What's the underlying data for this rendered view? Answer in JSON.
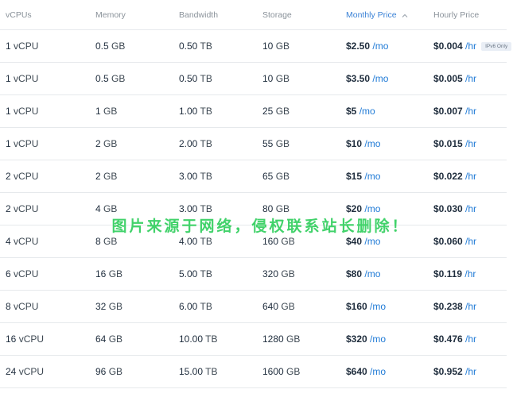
{
  "columns": {
    "vcpus": "vCPUs",
    "memory": "Memory",
    "bandwidth": "Bandwidth",
    "storage": "Storage",
    "monthly": "Monthly Price",
    "hourly": "Hourly Price"
  },
  "sort": {
    "column": "monthly",
    "direction": "ascending",
    "icon": "chevron-up-icon"
  },
  "units": {
    "vcpu": "vCPU",
    "memory": "GB",
    "bandwidth": "TB",
    "storage": "GB",
    "month": "/mo",
    "hour": "/hr"
  },
  "plans": [
    {
      "vcpus": "1",
      "memory": "0.5",
      "bandwidth": "0.50",
      "storage": "10",
      "monthly": "$2.50",
      "hourly": "$0.004",
      "badge": "IPv6 Only"
    },
    {
      "vcpus": "1",
      "memory": "0.5",
      "bandwidth": "0.50",
      "storage": "10",
      "monthly": "$3.50",
      "hourly": "$0.005"
    },
    {
      "vcpus": "1",
      "memory": "1",
      "bandwidth": "1.00",
      "storage": "25",
      "monthly": "$5",
      "hourly": "$0.007"
    },
    {
      "vcpus": "1",
      "memory": "2",
      "bandwidth": "2.00",
      "storage": "55",
      "monthly": "$10",
      "hourly": "$0.015"
    },
    {
      "vcpus": "2",
      "memory": "2",
      "bandwidth": "3.00",
      "storage": "65",
      "monthly": "$15",
      "hourly": "$0.022"
    },
    {
      "vcpus": "2",
      "memory": "4",
      "bandwidth": "3.00",
      "storage": "80",
      "monthly": "$20",
      "hourly": "$0.030"
    },
    {
      "vcpus": "4",
      "memory": "8",
      "bandwidth": "4.00",
      "storage": "160",
      "monthly": "$40",
      "hourly": "$0.060"
    },
    {
      "vcpus": "6",
      "memory": "16",
      "bandwidth": "5.00",
      "storage": "320",
      "monthly": "$80",
      "hourly": "$0.119"
    },
    {
      "vcpus": "8",
      "memory": "32",
      "bandwidth": "6.00",
      "storage": "640",
      "monthly": "$160",
      "hourly": "$0.238"
    },
    {
      "vcpus": "16",
      "memory": "64",
      "bandwidth": "10.00",
      "storage": "1280",
      "monthly": "$320",
      "hourly": "$0.476"
    },
    {
      "vcpus": "24",
      "memory": "96",
      "bandwidth": "15.00",
      "storage": "1600",
      "monthly": "$640",
      "hourly": "$0.952"
    }
  ],
  "watermark": "图片来源于网络，侵权联系站长删除！",
  "colors": {
    "accent": "#1f7ad6",
    "header_text": "#8a929a",
    "divider": "#e6e9ec",
    "watermark": "#41d26a"
  }
}
